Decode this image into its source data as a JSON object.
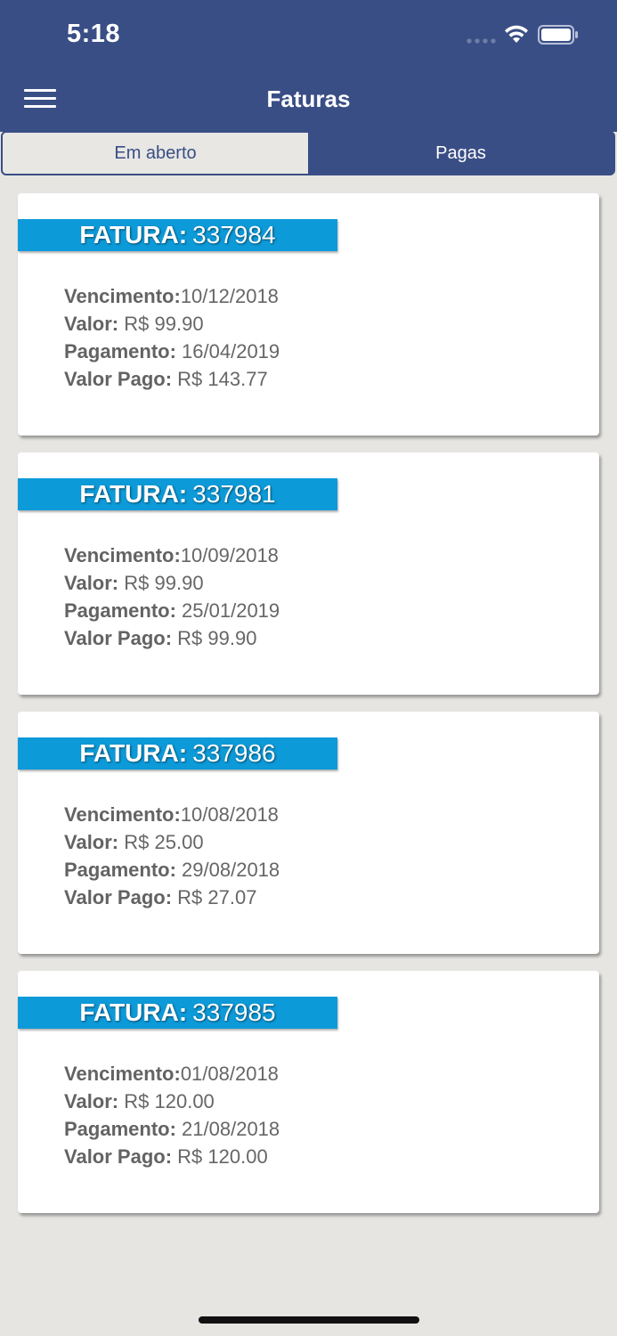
{
  "status_bar": {
    "time": "5:18"
  },
  "header": {
    "title": "Faturas",
    "menu_icon": "hamburger-menu-icon"
  },
  "tabs": [
    {
      "label": "Em aberto",
      "selected": true
    },
    {
      "label": "Pagas",
      "selected": false
    }
  ],
  "labels": {
    "invoice_prefix": "FATURA:",
    "due": "Vencimento:",
    "value": "Valor:",
    "payment": "Pagamento:",
    "paid": "Valor Pago:"
  },
  "invoices": [
    {
      "number": "337984",
      "due": "10/12/2018",
      "value": "R$ 99.90",
      "payment": "16/04/2019",
      "paid": "R$ 143.77"
    },
    {
      "number": "337981",
      "due": "10/09/2018",
      "value": "R$ 99.90",
      "payment": "25/01/2019",
      "paid": "R$ 99.90"
    },
    {
      "number": "337986",
      "due": "10/08/2018",
      "value": "R$ 25.00",
      "payment": "29/08/2018",
      "paid": "R$ 27.07"
    },
    {
      "number": "337985",
      "due": "01/08/2018",
      "value": "R$ 120.00",
      "payment": "21/08/2018",
      "paid": "R$ 120.00"
    }
  ],
  "colors": {
    "header_bg": "#3a4e86",
    "banner_bg": "#0d9ad9",
    "page_bg": "#e6e5e2"
  }
}
